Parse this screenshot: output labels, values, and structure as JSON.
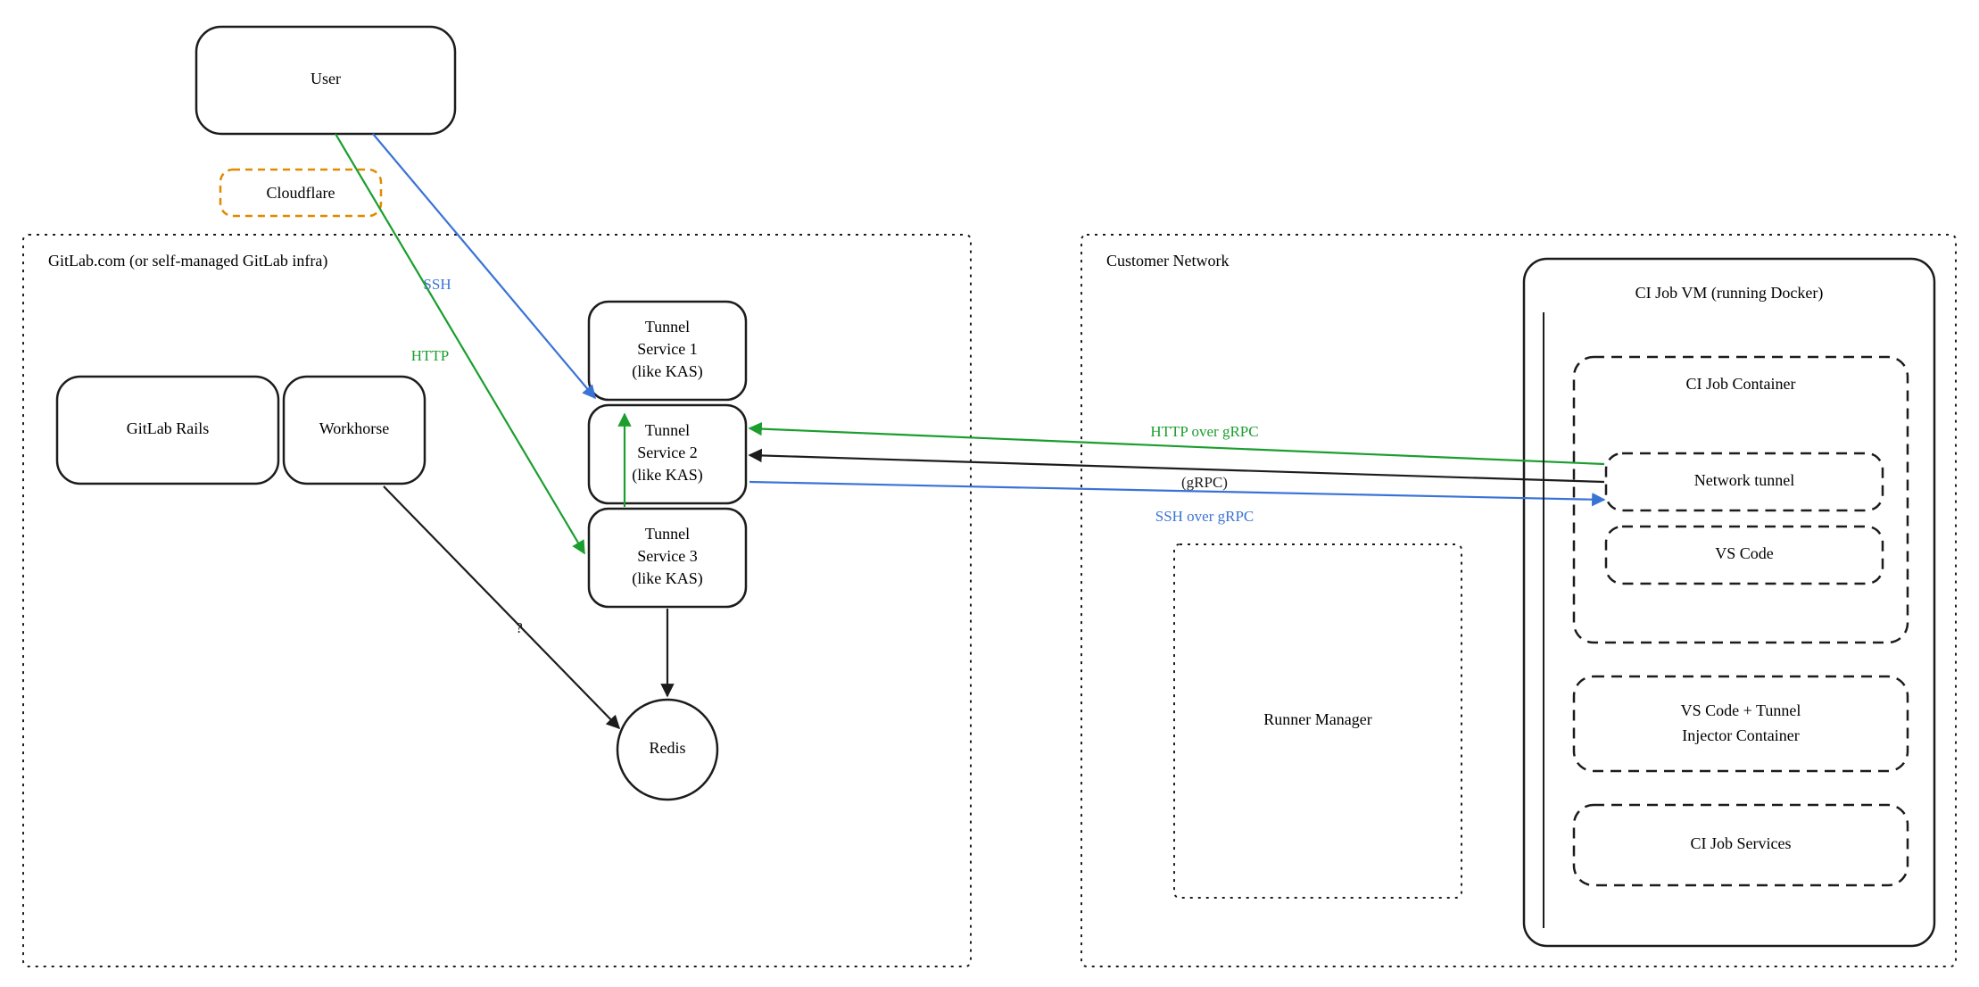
{
  "nodes": {
    "user": "User",
    "cloudflare": "Cloudflare",
    "gitlab_infra_title": "GitLab.com (or self-managed GitLab infra)",
    "gitlab_rails": "GitLab Rails",
    "workhorse": "Workhorse",
    "tunnel1_l1": "Tunnel",
    "tunnel1_l2": "Service 1",
    "tunnel1_l3": "(like KAS)",
    "tunnel2_l1": "Tunnel",
    "tunnel2_l2": "Service 2",
    "tunnel2_l3": "(like KAS)",
    "tunnel3_l1": "Tunnel",
    "tunnel3_l2": "Service 3",
    "tunnel3_l3": "(like KAS)",
    "redis": "Redis",
    "customer_network_title": "Customer Network",
    "runner_manager": "Runner Manager",
    "ci_job_vm_title": "CI Job VM (running Docker)",
    "ci_job_container_title": "CI Job Container",
    "network_tunnel": "Network tunnel",
    "vs_code": "VS Code",
    "injector_l1": "VS Code + Tunnel",
    "injector_l2": "Injector Container",
    "ci_job_services": "CI Job Services"
  },
  "edges": {
    "ssh": "SSH",
    "http": "HTTP",
    "question": "?",
    "http_over_grpc": "HTTP over gRPC",
    "grpc": "(gRPC)",
    "ssh_over_grpc": "SSH over gRPC"
  },
  "colors": {
    "black": "#1c1c1c",
    "green": "#1b9e2e",
    "blue": "#3a73d6",
    "orange": "#e08a00"
  }
}
